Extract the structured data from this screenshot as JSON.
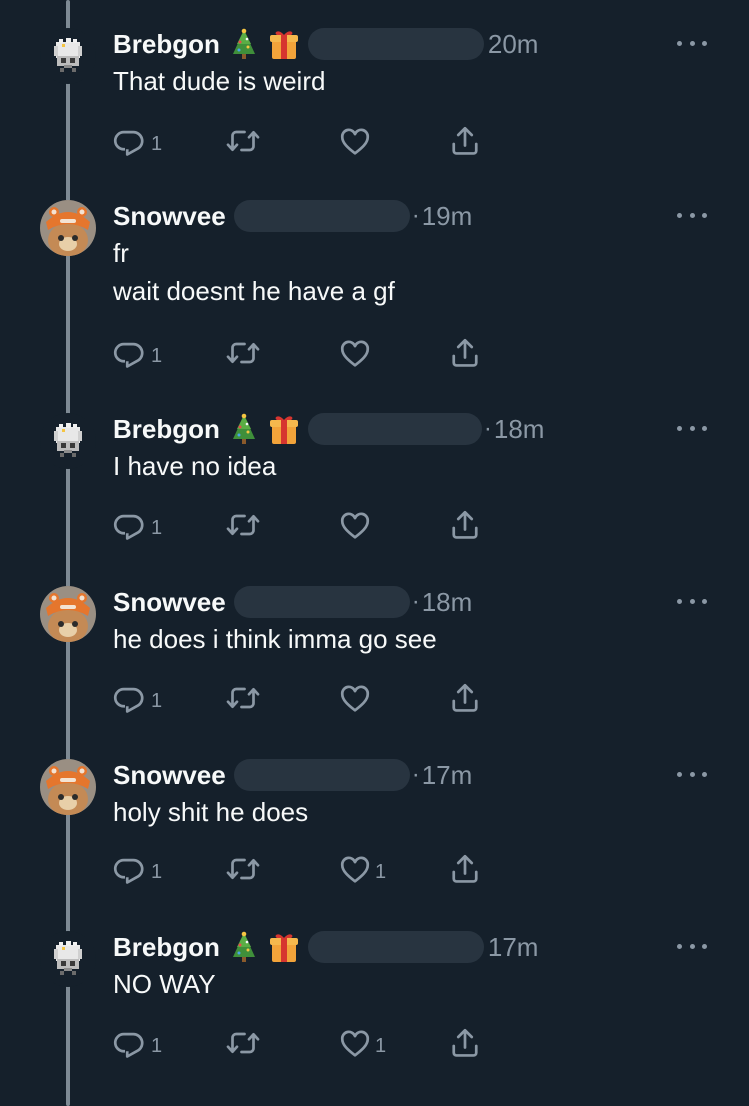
{
  "tweets": [
    {
      "author": "Brebgon",
      "avatar": "pixel-creature-avatar",
      "badges": [
        "christmas-tree-emoji",
        "gift-emoji"
      ],
      "time": "20m",
      "dot": "",
      "lines": [
        "That dude is weird"
      ],
      "replies": "1",
      "retweets": "",
      "likes": ""
    },
    {
      "author": "Snowvee",
      "avatar": "cat-in-hat-avatar",
      "badges": [],
      "time": "19m",
      "dot": "·",
      "lines": [
        "fr",
        "wait doesnt he have a gf"
      ],
      "replies": "1",
      "retweets": "",
      "likes": ""
    },
    {
      "author": "Brebgon",
      "avatar": "pixel-creature-avatar",
      "badges": [
        "christmas-tree-emoji",
        "gift-emoji"
      ],
      "time": "18m",
      "dot": "·",
      "lines": [
        "I have no idea"
      ],
      "replies": "1",
      "retweets": "",
      "likes": ""
    },
    {
      "author": "Snowvee",
      "avatar": "cat-in-hat-avatar",
      "badges": [],
      "time": "18m",
      "dot": "·",
      "lines": [
        "he does i think imma go see"
      ],
      "replies": "1",
      "retweets": "",
      "likes": ""
    },
    {
      "author": "Snowvee",
      "avatar": "cat-in-hat-avatar",
      "badges": [],
      "time": "17m",
      "dot": "·",
      "lines": [
        "holy shit he does"
      ],
      "replies": "1",
      "retweets": "",
      "likes": "1"
    },
    {
      "author": "Brebgon",
      "avatar": "pixel-creature-avatar",
      "badges": [
        "christmas-tree-emoji",
        "gift-emoji"
      ],
      "time": "17m",
      "dot": "",
      "lines": [
        "NO WAY"
      ],
      "replies": "1",
      "retweets": "",
      "likes": "1"
    }
  ],
  "colors": {
    "background": "#15202b",
    "text": "#f7f9f9",
    "muted": "#8b98a5",
    "thread_line": "#7e8a94",
    "handle_redaction": "#283440"
  },
  "icons": {
    "reply": "reply-icon",
    "retweet": "retweet-icon",
    "like": "heart-icon",
    "share": "share-icon",
    "more": "more-icon"
  }
}
